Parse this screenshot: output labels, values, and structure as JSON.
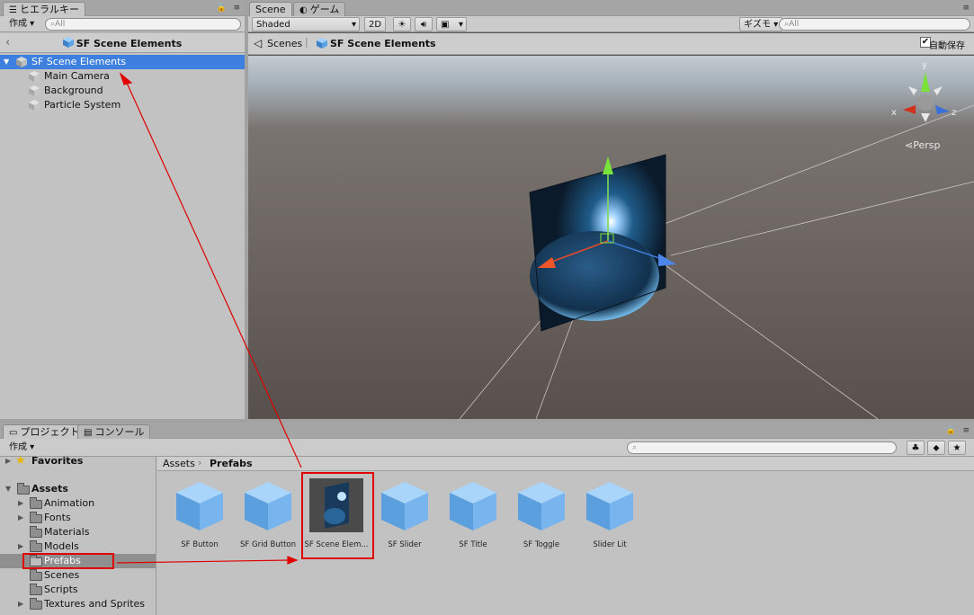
{
  "hierarchy": {
    "tab_label": "ヒエラルキー",
    "create_label": "作成 ▾",
    "search_placeholder": "All",
    "breadcrumb_title": "SF Scene Elements",
    "root_item": "SF Scene Elements",
    "children": [
      "Main Camera",
      "Background",
      "Particle System"
    ]
  },
  "scene": {
    "tabs": [
      "Scene",
      "ゲーム"
    ],
    "shading_mode": "Shaded",
    "mode_2d": "2D",
    "gizmos_label": "ギズモ",
    "search_placeholder": "All",
    "breadcrumb_root": "Scenes",
    "breadcrumb_current": "SF Scene Elements",
    "autosave_label": "自動保存",
    "autosave_checked": true,
    "persp_label": "Persp",
    "axis_labels": {
      "x": "x",
      "y": "y",
      "z": "z"
    }
  },
  "project": {
    "tabs": [
      "プロジェクト",
      "コンソール"
    ],
    "create_label": "作成 ▾",
    "favorites_label": "Favorites",
    "assets_label": "Assets",
    "folders": [
      "Animation",
      "Fonts",
      "Materials",
      "Models",
      "Prefabs",
      "Scenes",
      "Scripts",
      "Textures and Sprites"
    ],
    "selected_folder": "Prefabs",
    "path": [
      "Assets",
      "Prefabs"
    ],
    "items": [
      "SF Button",
      "SF Grid Button",
      "SF Scene Elem...",
      "SF Slider",
      "SF Title",
      "SF Toggle",
      "Slider Lit"
    ]
  },
  "colors": {
    "selection_blue": "#3d80df",
    "highlight_red": "#e00000",
    "cube_blue": "#6aaef0",
    "scene_sky": "#a0aeb8",
    "scene_ground": "#5e5652"
  }
}
